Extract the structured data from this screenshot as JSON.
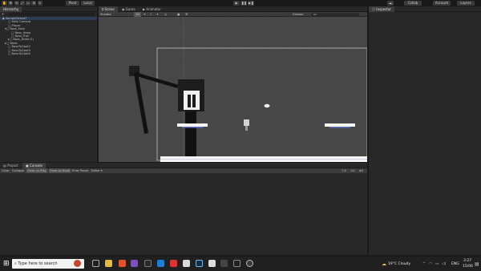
{
  "toolbar": {
    "tools": [
      "✥",
      "✋",
      "⟲",
      "⤢",
      "▭",
      "⊞",
      "✕"
    ],
    "pivot": "Pivot",
    "local": "Local",
    "play": "▶",
    "pause": "❚❚",
    "step": "▶❚",
    "collab": "Collab",
    "account": "Account",
    "layers": "Layers"
  },
  "hierarchy": {
    "tab": "Hierarchy",
    "add": "+",
    "scene_name": "SampleScene*",
    "items": [
      "Main Camera",
      "Player",
      "Boss_Main",
      "Boss_Head",
      "Boss_Trail",
      "Boss_Head (1)",
      "Walls",
      "BossTp2pot2",
      "BossTp2pot3",
      "BossTp2pot0"
    ]
  },
  "scene": {
    "tabs": [
      "Scene",
      "Game",
      "Animator"
    ],
    "shading": "Shaded",
    "mode_2d": "2D",
    "gizmos": "Gizmos",
    "search": "All"
  },
  "inspector": {
    "tab": "Inspector"
  },
  "console": {
    "tabs": [
      "Project",
      "Console"
    ],
    "buttons": [
      "Clear",
      "Collapse",
      "Clear on Play",
      "Clear on Build",
      "Error Pause",
      "Editor ▾"
    ],
    "counts": [
      "0",
      "0",
      "0"
    ]
  },
  "taskbar": {
    "search_placeholder": "Type here to search",
    "weather": "19°C  Cloudy",
    "lang": "ENG",
    "time": "3:27",
    "date": "15/06"
  }
}
